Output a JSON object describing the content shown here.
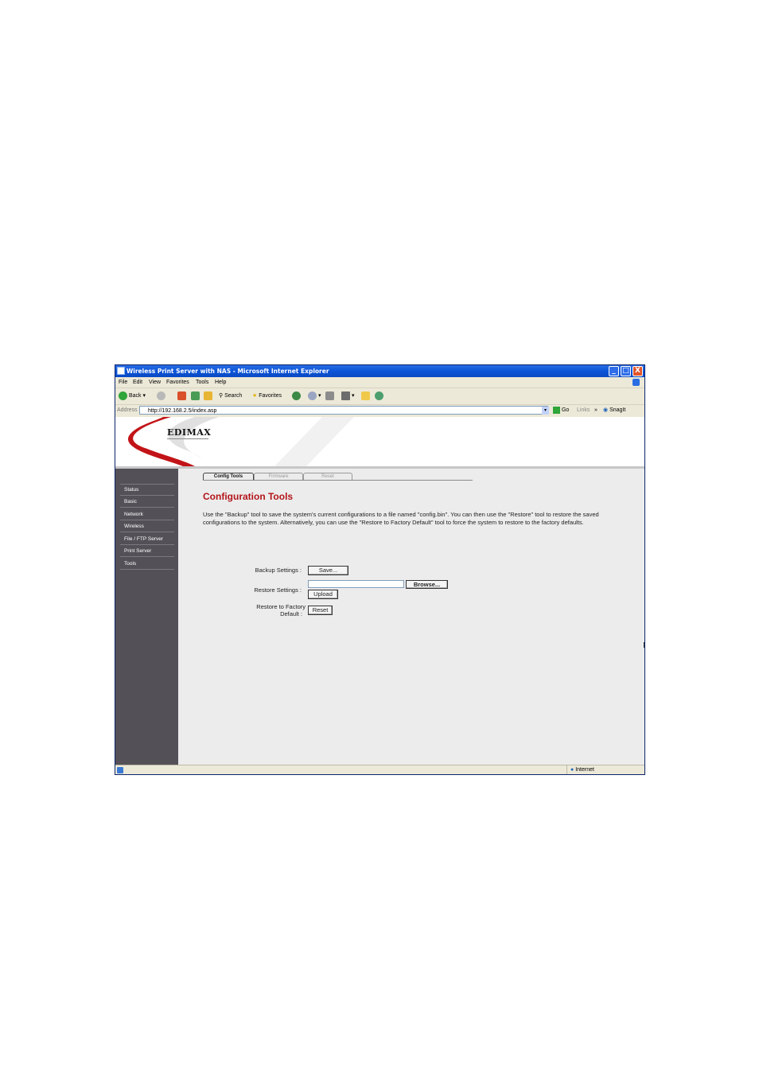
{
  "window": {
    "title": "Wireless Print Server with NAS - Microsoft Internet Explorer",
    "minimize": "_",
    "maximize": "□",
    "close": "X"
  },
  "menu": [
    "File",
    "Edit",
    "View",
    "Favorites",
    "Tools",
    "Help"
  ],
  "toolbar": {
    "back": "Back",
    "search": "Search",
    "favorites": "Favorites"
  },
  "address": {
    "label": "Address",
    "url": "http://192.168.2.5/index.asp",
    "go": "Go",
    "links": "Links",
    "snagit": "SnagIt"
  },
  "brand": {
    "logo": "EDIMAX"
  },
  "sidebar": {
    "items": [
      {
        "label": "Status"
      },
      {
        "label": "Basic"
      },
      {
        "label": "Network"
      },
      {
        "label": "Wireless"
      },
      {
        "label": "File / FTP Server"
      },
      {
        "label": "Print Server"
      },
      {
        "label": "Tools"
      }
    ]
  },
  "tabs": [
    {
      "label": "Config Tools",
      "active": true
    },
    {
      "label": "Firmware",
      "active": false
    },
    {
      "label": "Reset",
      "active": false
    }
  ],
  "main": {
    "title": "Configuration Tools",
    "description": "Use the \"Backup\" tool to save the system's current configurations to a file named \"config.bin\". You can then use the \"Restore\" tool to restore the saved configurations to the system. Alternatively, you can use the \"Restore to Factory Default\" tool to force the system to restore to the factory defaults.",
    "backup_label": "Backup Settings :",
    "save_button": "Save...",
    "restore_label": "Restore Settings :",
    "browse_button": "Browse...",
    "upload_button": "Upload",
    "factory_label_line1": "Restore to Factory",
    "factory_label_line2": "Default :",
    "reset_button": "Reset"
  },
  "status": {
    "zone": "Internet"
  },
  "colors": {
    "title_red": "#b3151b",
    "sidebar_bg": "#545057",
    "xp_blue": "#0b54d8"
  }
}
